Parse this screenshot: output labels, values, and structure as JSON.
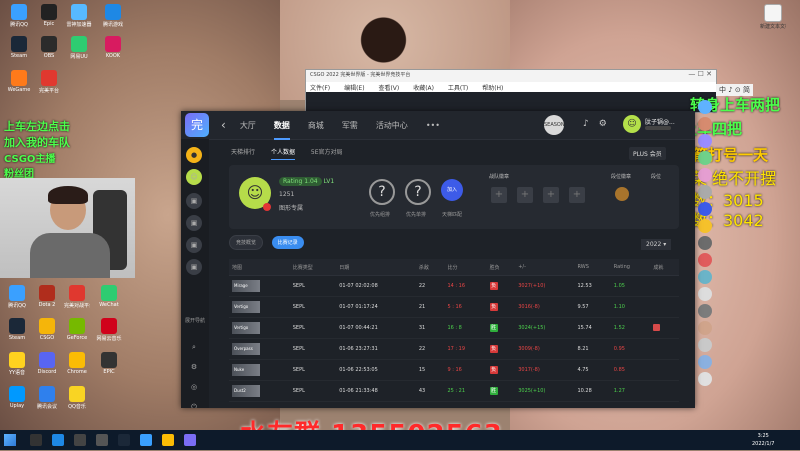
{
  "desktop": {
    "icons_col1": [
      "腾讯QQ",
      "Steam",
      "WeGame",
      "雷神加速器",
      "网易UU",
      "腾讯游戏"
    ],
    "icons_col2": [
      "Epic",
      "OBS",
      "完美平台",
      "KOOK"
    ],
    "icons_bottom": [
      "腾讯QQ",
      "Dota 2",
      "完美对战平台",
      "WeChat",
      "Steam",
      "CSGO",
      "GeForce",
      "网易云音乐",
      "YY语音",
      "Discord",
      "Chrome",
      "EPIC",
      "Uplay",
      "腾讯会议",
      "QQ音乐"
    ],
    "icons_right": [
      "新建文本文档"
    ]
  },
  "overlay": {
    "green_lines": [
      "上车左边点击",
      "加入我的车队",
      "CSGO主播",
      "粉丝团"
    ],
    "right_green": [
      "转身上车两把",
      "钻石上车四把",
      "火箭打号一天"
    ],
    "right_yellow": [
      "打的再菜 绝不开摆",
      "开播分数：3015",
      "目前分数：3042"
    ],
    "red_text": "水友群 135502563"
  },
  "bg_window": {
    "title": "CSGO 2022 完美世界版 - 完美世界竞技平台",
    "menu": [
      "文件(F)",
      "编辑(E)",
      "查看(V)",
      "收藏(A)",
      "工具(T)",
      "帮助(H)"
    ]
  },
  "app": {
    "logo": "完",
    "nav": {
      "back": "‹",
      "items": [
        "大厅",
        "数据",
        "商城",
        "军需",
        "活动中心",
        "•••"
      ],
      "active": "数据"
    },
    "center_badge": "SEASON",
    "user_name": "肽子锅@...",
    "plus_member": "PLUS 会员",
    "sidebar": {
      "expand_label": "展开导航"
    },
    "subtabs": [
      "天梯排行",
      "个人数据",
      "5E官方对局"
    ],
    "active_subtab": "个人数据",
    "profile": {
      "rating_badge": "Rating 1.04",
      "level": "LV1",
      "points": "1251",
      "role": "图形专属",
      "circle1_label": "优先组排",
      "circle2_label": "优先单排",
      "join_label": "加入",
      "join_sub": "天梯匹配",
      "medals_label": "战队徽章",
      "rank_label": "段位徽章",
      "rank_label2": "段位"
    },
    "segments": [
      "竞技概览",
      "比赛记录"
    ],
    "active_segment": "比赛记录",
    "season": "2022",
    "table": {
      "headers": [
        "地图",
        "比赛类型",
        "日期",
        "杀敌",
        "比分",
        "胜负",
        "+/-",
        "RWS",
        "Rating",
        "成就"
      ],
      "rows": [
        {
          "map": "Mirage",
          "type": "SEPL",
          "date": "01-07 02:02:08",
          "kills": "22",
          "score": "14 : 16",
          "win": false,
          "diff": "3027(+10)",
          "rws": "12.53",
          "rating": "1.05",
          "award": false
        },
        {
          "map": "Vertigo",
          "type": "SEPL",
          "date": "01-07 01:17:24",
          "kills": "21",
          "score": "5 : 16",
          "win": false,
          "diff": "3016(-8)",
          "rws": "9.57",
          "rating": "1.10",
          "award": false
        },
        {
          "map": "Vertigo",
          "type": "SEPL",
          "date": "01-07 00:44:21",
          "kills": "31",
          "score": "16 : 8",
          "win": true,
          "diff": "3024(+15)",
          "rws": "15.74",
          "rating": "1.52",
          "award": true
        },
        {
          "map": "Overpass",
          "type": "SEPL",
          "date": "01-06 23:27:31",
          "kills": "22",
          "score": "17 : 19",
          "win": false,
          "diff": "3009(-8)",
          "rws": "8.21",
          "rating": "0.95",
          "award": false
        },
        {
          "map": "Nuke",
          "type": "SEPL",
          "date": "01-06 22:53:05",
          "kills": "15",
          "score": "9 : 16",
          "win": false,
          "diff": "3017(-8)",
          "rws": "4.75",
          "rating": "0.85",
          "award": false
        },
        {
          "map": "Dust2",
          "type": "SEPL",
          "date": "01-06 21:33:48",
          "kills": "43",
          "score": "25 : 21",
          "win": true,
          "diff": "3025(+10)",
          "rws": "10.28",
          "rating": "1.27",
          "award": false
        }
      ]
    }
  },
  "tray": {
    "ime": "中 ♪ ⊙ 简"
  },
  "clock": {
    "time": "3:25",
    "date": "2022/1/7"
  },
  "colors": {
    "accent": "#3a8df0",
    "win": "#2fae3c",
    "loss": "#d73a3a",
    "overlay_green": "#4cff4c",
    "overlay_yellow": "#ffe400",
    "overlay_red": "#ff2a2a"
  }
}
